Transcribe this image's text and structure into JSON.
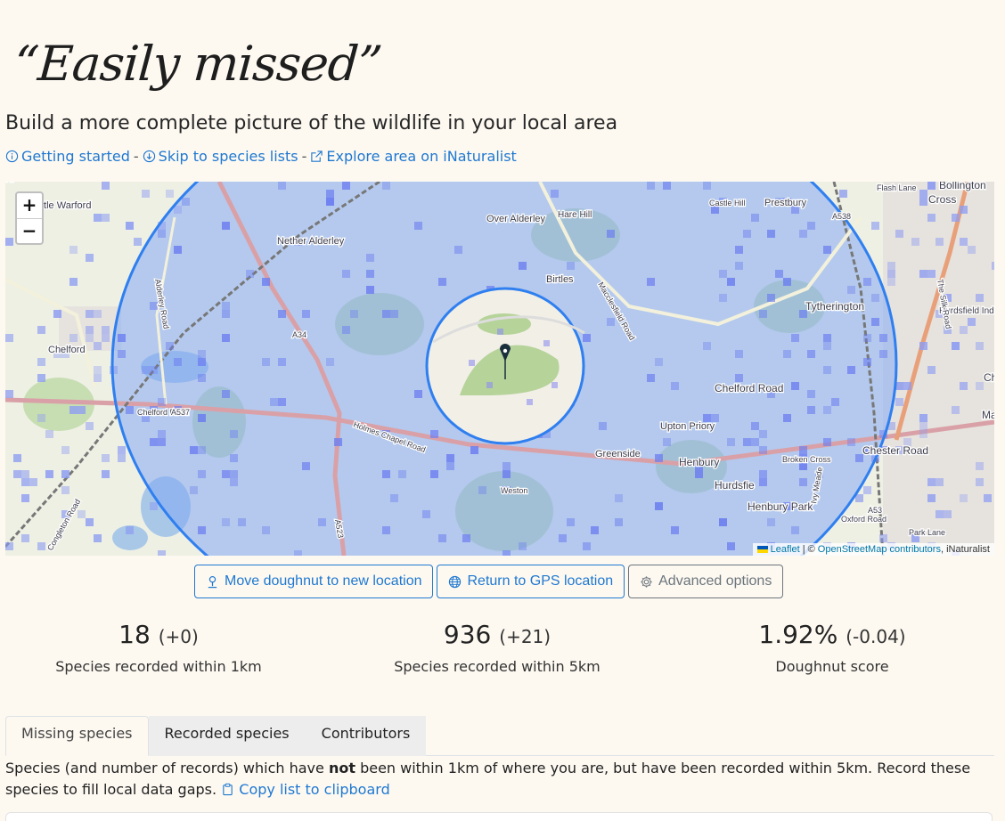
{
  "header": {
    "title": "“Easily missed”",
    "subtitle": "Build a more complete picture of the wildlife in your local area"
  },
  "links": {
    "getting_started": "Getting started",
    "separator1": "-",
    "skip": "Skip to species lists",
    "separator2": "-",
    "explore": "Explore area on iNaturalist"
  },
  "map": {
    "zoom_in": "+",
    "zoom_out": "−",
    "place_labels": [
      "ttle Warford",
      "Nether Alderley",
      "Over Alderley",
      "Hare Hill",
      "Castle Hill",
      "Prestbury",
      "A538",
      "Flash Lane",
      "Bollington",
      "Cross",
      "Birtles",
      "Macclesfield Road",
      "Tytherington",
      "Hurdsfield Industrial Estate",
      "The Silk Road",
      "Chelford",
      "A34",
      "Alderley Road",
      "Chelford Road",
      "A537",
      "Chelford Road",
      "Upton Priory",
      "Greenside",
      "Henbury",
      "Broken Cross",
      "Chester Road",
      "Macclesfield",
      "Hurdsfie",
      "Weston",
      "Henbury Park",
      "Ivy Meade",
      "Oxford Road",
      "A53",
      "Park Lane",
      "A523",
      "Congleton Road",
      "Holmes Chapel Road",
      "Chelford Road",
      "Hi"
    ],
    "attribution": {
      "leaflet": "Leaflet",
      "sep": "| ©",
      "osm": "OpenStreetMap contributors",
      "inat": ", iNaturalist"
    }
  },
  "buttons": {
    "move": "Move doughnut to new location",
    "gps": "Return to GPS location",
    "advanced": "Advanced options"
  },
  "stats": [
    {
      "value": "18",
      "delta": "(+0)",
      "label": "Species recorded within 1km"
    },
    {
      "value": "936",
      "delta": "(+21)",
      "label": "Species recorded within 5km"
    },
    {
      "value": "1.92%",
      "delta": "(-0.04)",
      "label": "Doughnut score"
    }
  ],
  "tabs": [
    {
      "label": "Missing species",
      "active": true
    },
    {
      "label": "Recorded species",
      "active": false
    },
    {
      "label": "Contributors",
      "active": false
    }
  ],
  "description": {
    "part1": "Species (and number of records) which have ",
    "bold": "not",
    "part2": " been within 1km of where you are, but have been recorded within 5km. Record these species to fill local data gaps.",
    "copy": "Copy list to clipboard"
  },
  "colors": {
    "accent": "#1f78d1",
    "background": "#fdf9f1",
    "circle": "#2f7ff0",
    "overlay": "#7ea4f5"
  }
}
